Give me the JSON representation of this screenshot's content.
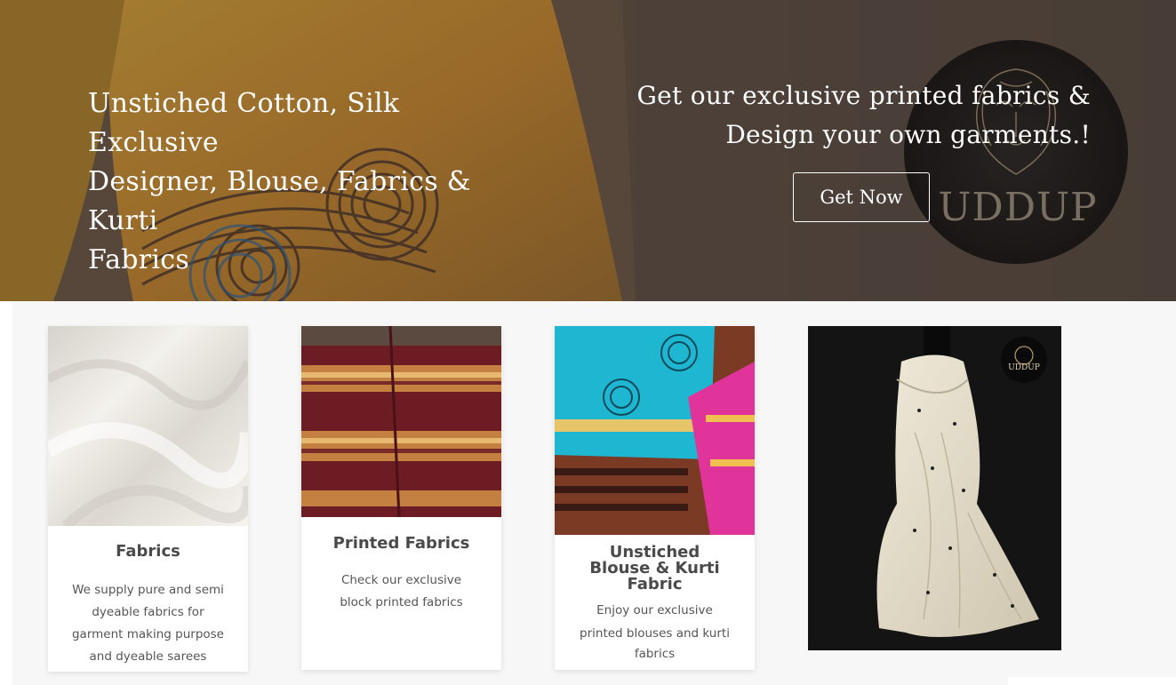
{
  "hero": {
    "left_text_lines": [
      "Unstiched Cotton, Silk Exclusive",
      "Designer, Blouse, Fabrics & Kurti",
      "Fabrics"
    ],
    "right_text_lines": [
      "Get our exclusive printed fabrics &",
      "Design your own garments.!"
    ],
    "cta_label": "Get Now",
    "logo_text": "UDDUP"
  },
  "cards": [
    {
      "title": "Fabrics",
      "description_lines": [
        "We supply pure and semi",
        "dyeable fabrics for",
        "garment making purpose",
        "and dyeable sarees"
      ],
      "image": "white-silk-fabric"
    },
    {
      "title": "Printed Fabrics",
      "description_lines": [
        "Check our exclusive",
        "block printed fabrics"
      ],
      "image": "maroon-printed-fabric"
    },
    {
      "title_lines": [
        "Unstiched",
        "Blouse & Kurti",
        "Fabric"
      ],
      "description_lines": [
        "Enjoy our exclusive",
        "printed blouses and kurti",
        "fabrics"
      ],
      "image": "blue-pink-blouse-fabric"
    },
    {
      "image": "cream-saree-on-mannequin",
      "badge_text": "UDDUP"
    }
  ],
  "colors": {
    "title_text": "#4a4a4a",
    "body_text": "#555555",
    "hero_text": "#ffffff"
  }
}
